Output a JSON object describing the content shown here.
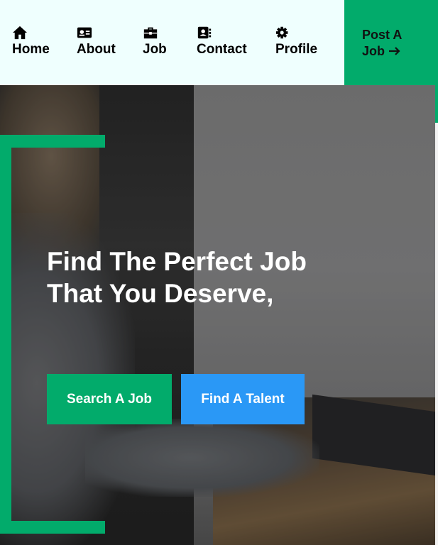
{
  "nav": {
    "items": [
      {
        "label": "Home",
        "icon": "home-icon"
      },
      {
        "label": "About",
        "icon": "id-card-icon"
      },
      {
        "label": "Job",
        "icon": "briefcase-icon"
      },
      {
        "label": "Contact",
        "icon": "address-book-icon"
      },
      {
        "label": "Profile",
        "icon": "gear-icon"
      }
    ],
    "post_job": {
      "line1": "Post A",
      "line2": "Job",
      "icon": "arrow-right-icon"
    }
  },
  "hero": {
    "headline_line1": "Find The Perfect Job",
    "headline_line2": "That You Deserve,",
    "search_button": "Search A Job",
    "talent_button": "Find A Talent"
  },
  "colors": {
    "nav_bg": "#effffe",
    "accent_green": "#02ab6b",
    "accent_blue": "#2a98f6",
    "text_dark": "#000000",
    "text_light": "#ffffff"
  }
}
